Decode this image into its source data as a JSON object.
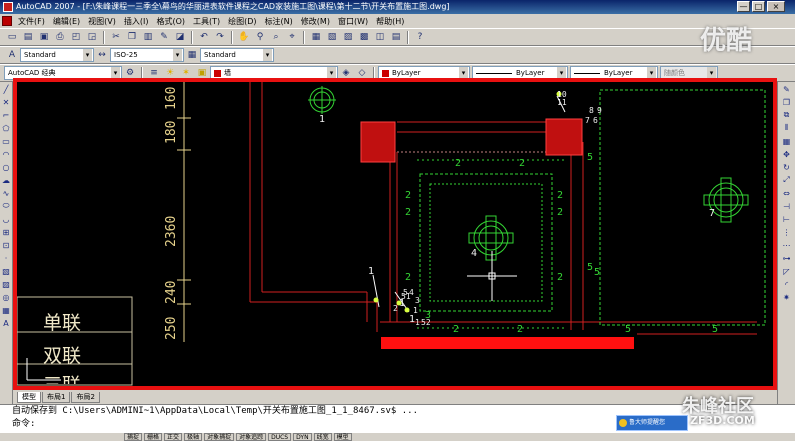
{
  "window": {
    "title": "AutoCAD 2007 - [F:\\朱峰课程一三季全\\幕鸟的华丽进表软件课程之CAD家装施工图\\课程\\第十二节\\开关布置施工图.dwg]",
    "min": "—",
    "max": "□",
    "close": "×"
  },
  "menu": [
    "文件(F)",
    "编辑(E)",
    "视图(V)",
    "插入(I)",
    "格式(O)",
    "工具(T)",
    "绘图(D)",
    "标注(N)",
    "修改(M)",
    "窗口(W)",
    "帮助(H)"
  ],
  "toolbar": {
    "text_style": "Standard",
    "dim_style": "ISO-25",
    "table_style": "Standard",
    "workspace": "AutoCAD 经典",
    "layer": "墙",
    "color": "ByLayer",
    "linetype": "ByLayer",
    "lineweight": "ByLayer",
    "plotstyle": "随颜色",
    "accent_color": "#c00000"
  },
  "drawing": {
    "dimensions": [
      "160",
      "180",
      "2360",
      "240",
      "250"
    ],
    "legend": [
      "单联",
      "双联",
      "三联"
    ],
    "green_labels": [
      "2",
      "2",
      "2",
      "2",
      "2",
      "2",
      "2",
      "2",
      "5",
      "5",
      "5",
      "5",
      "5",
      "2",
      "2",
      "3"
    ],
    "white_labels": [
      "1",
      "4",
      "7",
      "1",
      "1",
      "1"
    ],
    "callouts": [
      "10",
      "11",
      "8",
      "9",
      "7",
      "6",
      "5",
      "4",
      "3",
      "2",
      "1",
      "51",
      "1",
      "52"
    ],
    "border_color": "#e81010"
  },
  "tabs": [
    "模型",
    "布局1",
    "布局2"
  ],
  "command": {
    "line1": "自动保存到 C:\\Users\\ADMINI~1\\AppData\\Local\\Temp\\开关布置施工图_1_1_8467.sv$ ...",
    "line2": "命令:"
  },
  "status": [
    "捕捉",
    "栅格",
    "正交",
    "极轴",
    "对象捕捉",
    "对象追踪",
    "DUCS",
    "DYN",
    "线宽",
    "模型"
  ],
  "overlay": {
    "top_mark": "优酷",
    "bottom_mark": "朱峰社区",
    "bottom_url": "ZF3D.COM",
    "notify": "鲁大师提醒您"
  }
}
